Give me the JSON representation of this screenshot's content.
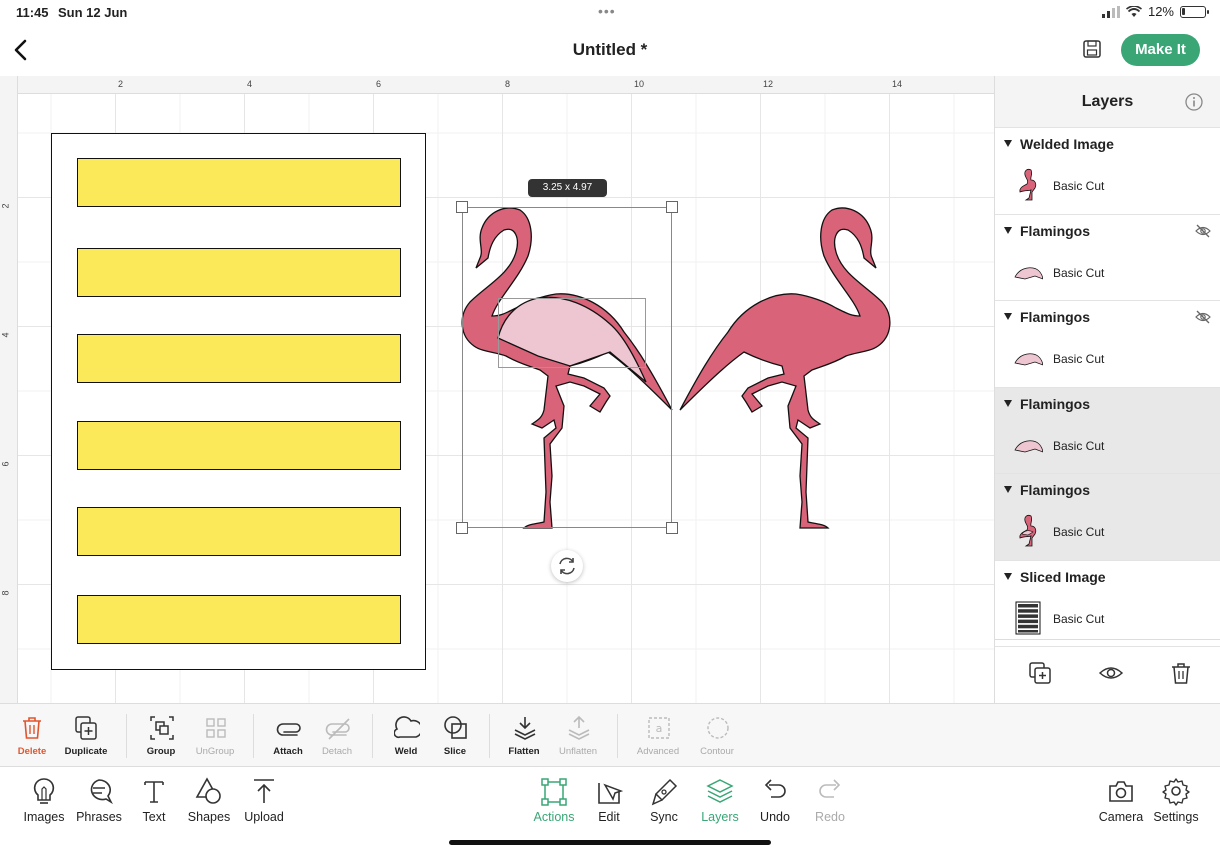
{
  "status": {
    "time": "11:45",
    "date": "Sun 12 Jun",
    "battery": "12%"
  },
  "header": {
    "title": "Untitled *",
    "make_it": "Make It"
  },
  "ruler": {
    "top_ticks": [
      "2",
      "4",
      "6",
      "8",
      "10",
      "12",
      "14"
    ],
    "left_ticks": [
      "2",
      "4",
      "6",
      "8"
    ]
  },
  "canvas": {
    "selection_size": "3.25 x 4.97"
  },
  "colors": {
    "accent": "#3aa676",
    "flamingo": "#d9647a",
    "wing": "#eec6d2",
    "strip": "#fbe95a",
    "delete": "#e0552e"
  },
  "layers": {
    "title": "Layers",
    "groups": [
      {
        "name": "Welded Image",
        "operation": "Basic Cut",
        "thumb": "flamingo-icon",
        "hidden": false
      },
      {
        "name": "Flamingos",
        "operation": "Basic Cut",
        "thumb": "wing-icon",
        "hidden": true
      },
      {
        "name": "Flamingos",
        "operation": "Basic Cut",
        "thumb": "wing-icon",
        "hidden": true
      },
      {
        "name": "Flamingos",
        "operation": "Basic Cut",
        "thumb": "wing-icon",
        "hidden": false
      },
      {
        "name": "Flamingos",
        "operation": "Basic Cut",
        "thumb": "flamingo-icon",
        "hidden": false
      },
      {
        "name": "Sliced Image",
        "operation": "Basic Cut",
        "thumb": "strips-icon",
        "hidden": false
      }
    ]
  },
  "toolbar": {
    "delete": "Delete",
    "duplicate": "Duplicate",
    "group": "Group",
    "ungroup": "UnGroup",
    "attach": "Attach",
    "detach": "Detach",
    "weld": "Weld",
    "slice": "Slice",
    "flatten": "Flatten",
    "unflatten": "Unflatten",
    "advanced": "Advanced",
    "contour": "Contour"
  },
  "nav": {
    "images": "Images",
    "phrases": "Phrases",
    "text": "Text",
    "shapes": "Shapes",
    "upload": "Upload",
    "actions": "Actions",
    "edit": "Edit",
    "sync": "Sync",
    "layers": "Layers",
    "undo": "Undo",
    "redo": "Redo",
    "camera": "Camera",
    "settings": "Settings"
  }
}
